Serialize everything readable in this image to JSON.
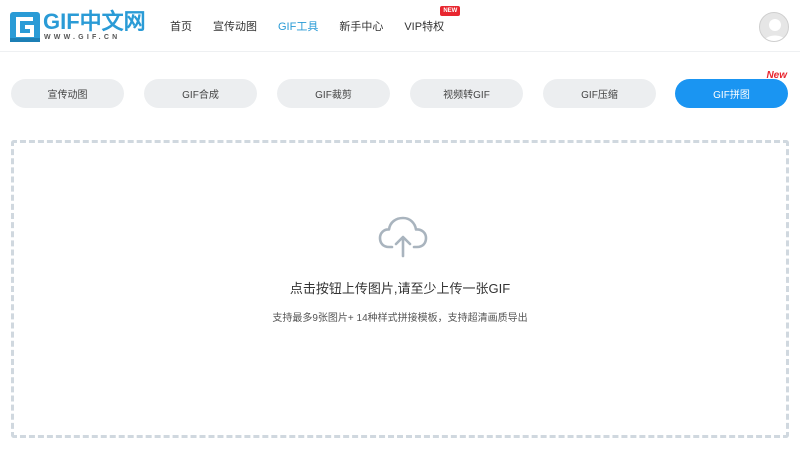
{
  "header": {
    "logo": {
      "title": "GIF中文网",
      "subtitle": "WWW.GIF.CN"
    },
    "nav": [
      {
        "label": "首页",
        "active": false
      },
      {
        "label": "宣传动图",
        "active": false
      },
      {
        "label": "GIF工具",
        "active": true
      },
      {
        "label": "新手中心",
        "active": false
      },
      {
        "label": "VIP特权",
        "active": false,
        "badge": "NEW"
      }
    ]
  },
  "tabs": [
    {
      "label": "宣传动图",
      "active": false
    },
    {
      "label": "GIF合成",
      "active": false
    },
    {
      "label": "GIF裁剪",
      "active": false
    },
    {
      "label": "视频转GIF",
      "active": false
    },
    {
      "label": "GIF压缩",
      "active": false
    },
    {
      "label": "GIF拼图",
      "active": true,
      "tag": "New"
    }
  ],
  "upload": {
    "icon": "cloud-upload-icon",
    "title": "点击按钮上传图片,请至少上传一张GIF",
    "subtitle": "支持最多9张图片+ 14种样式拼接模板，支持超清画质导出"
  },
  "colors": {
    "brand": "#2a9bd6",
    "active_tab": "#1a95f2",
    "badge": "#e8262f",
    "tab_bg": "#eceef0",
    "dash_border": "#d0d8df"
  }
}
